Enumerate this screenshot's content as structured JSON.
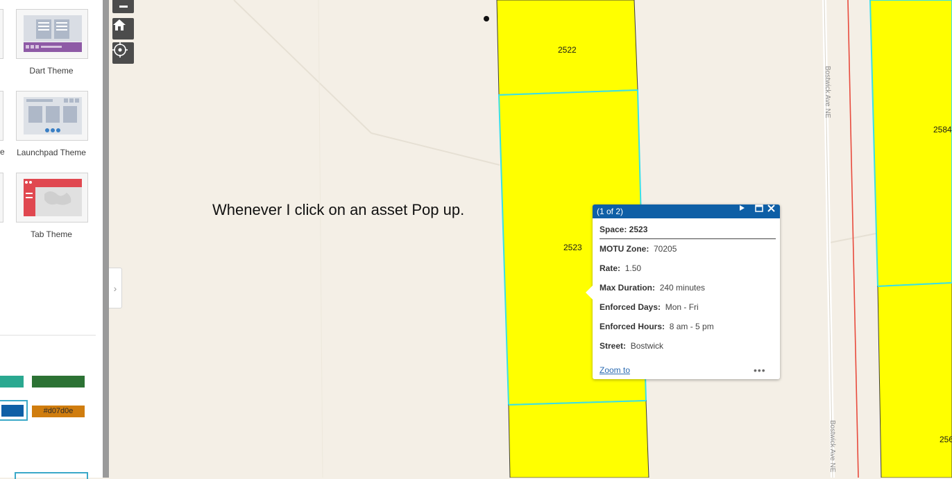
{
  "themes": [
    {
      "label": "Dart Theme"
    },
    {
      "label": "Launchpad Theme"
    },
    {
      "label": "Tab Theme"
    }
  ],
  "cut_label": "e",
  "swatches": {
    "teal": "#2aa890",
    "green": "#2c7234",
    "blue": "#0e5fa6",
    "orange_label": "#d07d0e"
  },
  "map": {
    "controls": [
      "zoom-out-icon",
      "home-icon",
      "locate-icon"
    ],
    "parcels": [
      "2522",
      "2523",
      "2584",
      "256"
    ],
    "street_label": "Bostwick Ave NE",
    "colors": {
      "parcel": "#ffff00",
      "parcel_border": "#3ae0e6",
      "road_red": "#e84a3c"
    }
  },
  "annotation": "Whenever I click on an asset Pop up.",
  "popup": {
    "counter": "(1 of 2)",
    "title": "Space: 2523",
    "fields": [
      {
        "label": "MOTU Zone:",
        "value": "70205"
      },
      {
        "label": "Rate:",
        "value": "1.50"
      },
      {
        "label": "Max Duration:",
        "value": "240 minutes"
      },
      {
        "label": "Enforced Days:",
        "value": "Mon - Fri"
      },
      {
        "label": "Enforced Hours:",
        "value": "8 am - 5 pm"
      },
      {
        "label": "Street:",
        "value": "Bostwick"
      }
    ],
    "zoom_link": "Zoom to",
    "more": "•••"
  }
}
